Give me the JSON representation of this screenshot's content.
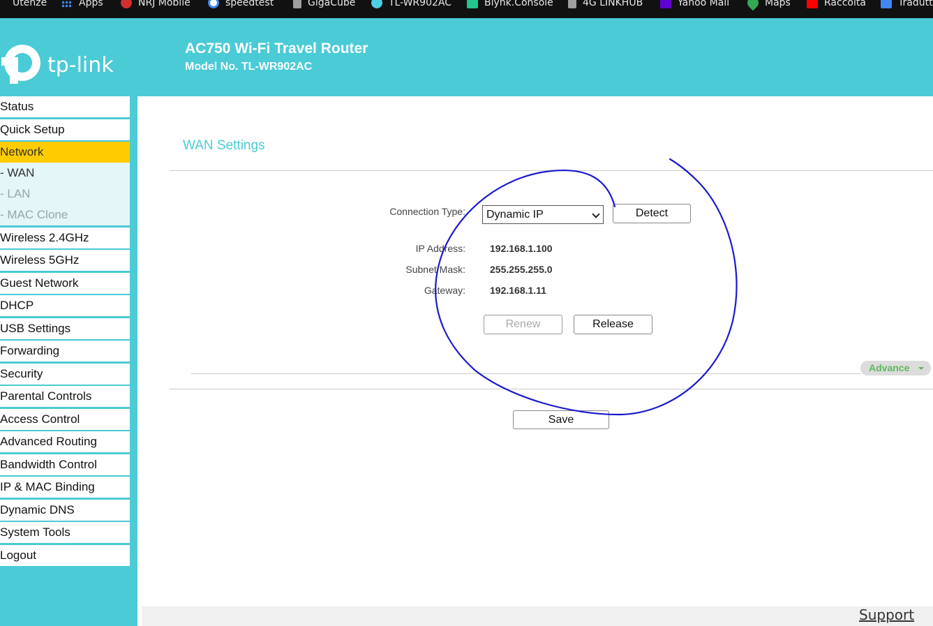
{
  "bookmarks": [
    {
      "label": "Utenze",
      "icon": "document-icon"
    },
    {
      "label": "Apps",
      "icon": "apps-grid-icon"
    },
    {
      "label": "NRJ Mobile",
      "icon": "nrj-icon"
    },
    {
      "label": "speedtest",
      "icon": "google-icon"
    },
    {
      "label": "GigaCube",
      "icon": "document-icon"
    },
    {
      "label": "TL-WR902AC",
      "icon": "tplink-icon"
    },
    {
      "label": "Blynk.Console",
      "icon": "blynk-icon"
    },
    {
      "label": "4G LINKHUB",
      "icon": "document-icon"
    },
    {
      "label": "Yahoo Mail",
      "icon": "yahoo-icon"
    },
    {
      "label": "Maps",
      "icon": "maps-icon"
    },
    {
      "label": "Raccolta",
      "icon": "youtube-icon"
    },
    {
      "label": "Tradutt",
      "icon": "translate-icon"
    }
  ],
  "header": {
    "brand": "tp-link",
    "product_title": "AC750 Wi-Fi Travel Router",
    "model": "Model No. TL-WR902AC"
  },
  "sidebar": {
    "items_top": [
      {
        "label": "Status"
      },
      {
        "label": "Quick Setup"
      },
      {
        "label": "Network"
      }
    ],
    "subitems": [
      {
        "label": "- WAN"
      },
      {
        "label": "- LAN"
      },
      {
        "label": "- MAC Clone"
      }
    ],
    "items_bottom": [
      {
        "label": "Wireless 2.4GHz"
      },
      {
        "label": "Wireless 5GHz"
      },
      {
        "label": "Guest Network"
      },
      {
        "label": "DHCP"
      },
      {
        "label": "USB Settings"
      },
      {
        "label": "Forwarding"
      },
      {
        "label": "Security"
      },
      {
        "label": "Parental Controls"
      },
      {
        "label": "Access Control"
      },
      {
        "label": "Advanced Routing"
      },
      {
        "label": "Bandwidth Control"
      },
      {
        "label": "IP & MAC Binding"
      },
      {
        "label": "Dynamic DNS"
      },
      {
        "label": "System Tools"
      },
      {
        "label": "Logout"
      }
    ]
  },
  "main": {
    "title": "WAN Settings",
    "connection_type_label": "Connection Type:",
    "connection_type_value": "Dynamic IP",
    "detect_label": "Detect",
    "ip_label": "IP Address:",
    "ip_value": "192.168.1.100",
    "subnet_label": "Subnet Mask:",
    "subnet_value": "255.255.255.0",
    "gateway_label": "Gateway:",
    "gateway_value": "192.168.1.11",
    "renew_label": "Renew",
    "release_label": "Release",
    "advance_label": "Advance",
    "save_label": "Save"
  },
  "footer": {
    "support_label": "Support"
  },
  "colors": {
    "brand_teal": "#4acbd6",
    "active_nav": "#ffcc00",
    "advance_green": "#5cb85c",
    "annotation_blue": "#1a1acc"
  }
}
